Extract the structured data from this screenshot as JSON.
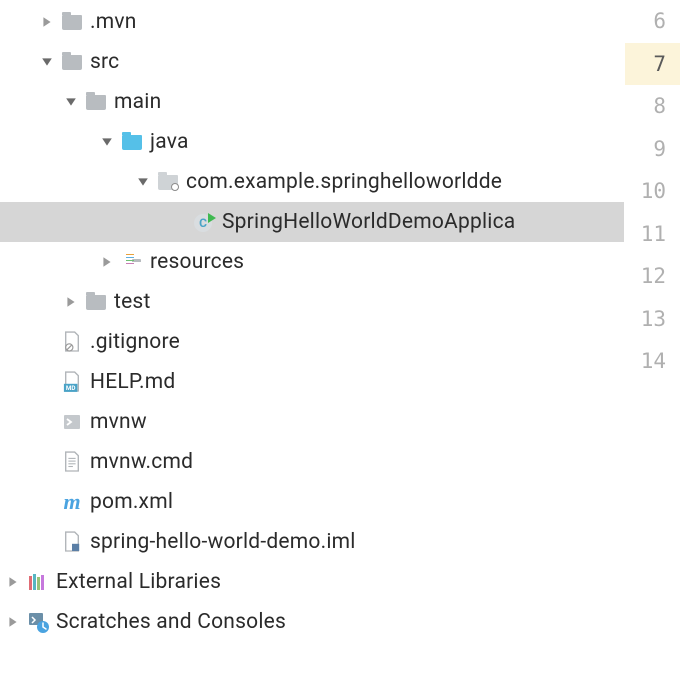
{
  "tree": {
    "mvn": ".mvn",
    "src": "src",
    "main": "main",
    "java": "java",
    "pkg": "com.example.springhelloworldde",
    "app": "SpringHelloWorldDemoApplica",
    "resources": "resources",
    "test": "test",
    "gitignore": ".gitignore",
    "help": "HELP.md",
    "mvnw": "mvnw",
    "mvnwcmd": "mvnw.cmd",
    "pom": "pom.xml",
    "iml": "spring-hello-world-demo.iml",
    "extlib": "External Libraries",
    "scratches": "Scratches and Consoles"
  },
  "gutter": {
    "l6": "6",
    "l7": "7",
    "l8": "8",
    "l9": "9",
    "l10": "10",
    "l11": "11",
    "l12": "12",
    "l13": "13",
    "l14": "14"
  }
}
